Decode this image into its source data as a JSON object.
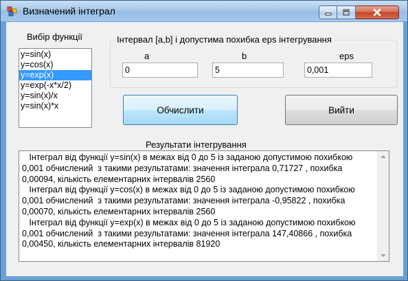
{
  "window": {
    "title": "Визначений інтеграл"
  },
  "function_selector": {
    "label": "Вибір функції",
    "items": [
      "y=sin(x)",
      "y=cos(x)",
      "y=exp(x)",
      "y=exp(-x*x/2)",
      "y=sin(x)/x",
      "y=sin(x)*x"
    ],
    "selected": "y=exp(x)"
  },
  "interval_group": {
    "legend": "Інтервал [a,b] і допустима похибка eps інтегрування",
    "a_label": "a",
    "b_label": "b",
    "eps_label": "eps",
    "a_value": "0",
    "b_value": "5",
    "eps_value": "0,001"
  },
  "buttons": {
    "calculate": "Обчислити",
    "exit": "Вийти"
  },
  "results": {
    "label": "Результати  інтегрування",
    "text": "   Інтеграл від функції y=sin(x) в межах від 0 до 5 із заданою допустимою похибкою 0,001 обчислений  з такими результатами: значення інтеграла 0,71727 , похибка 0,00094, кількість елементарних інтервалів 2560\n   Інтеграл від функції y=cos(x) в межах від 0 до 5 із заданою допустимою похибкою 0,001 обчислений  з такими результатами: значення інтеграла -0,95822 , похибка 0,00070, кількість елементарних інтервалів 2560\n   Інтеграл від функції y=exp(x) в межах від 0 до 5 із заданою допустимою похибкою 0,001 обчислений  з такими результатами: значення інтеграла 147,40866 , похибка 0,00450, кількість елементарних інтервалів 81920"
  },
  "icons": {
    "app": "app-icon",
    "minimize": "minimize-icon",
    "maximize": "maximize-icon",
    "close": "close-icon"
  },
  "colors": {
    "selection": "#3399ff",
    "close_button": "#c4442a",
    "title_bar": "#a9c9ea"
  }
}
